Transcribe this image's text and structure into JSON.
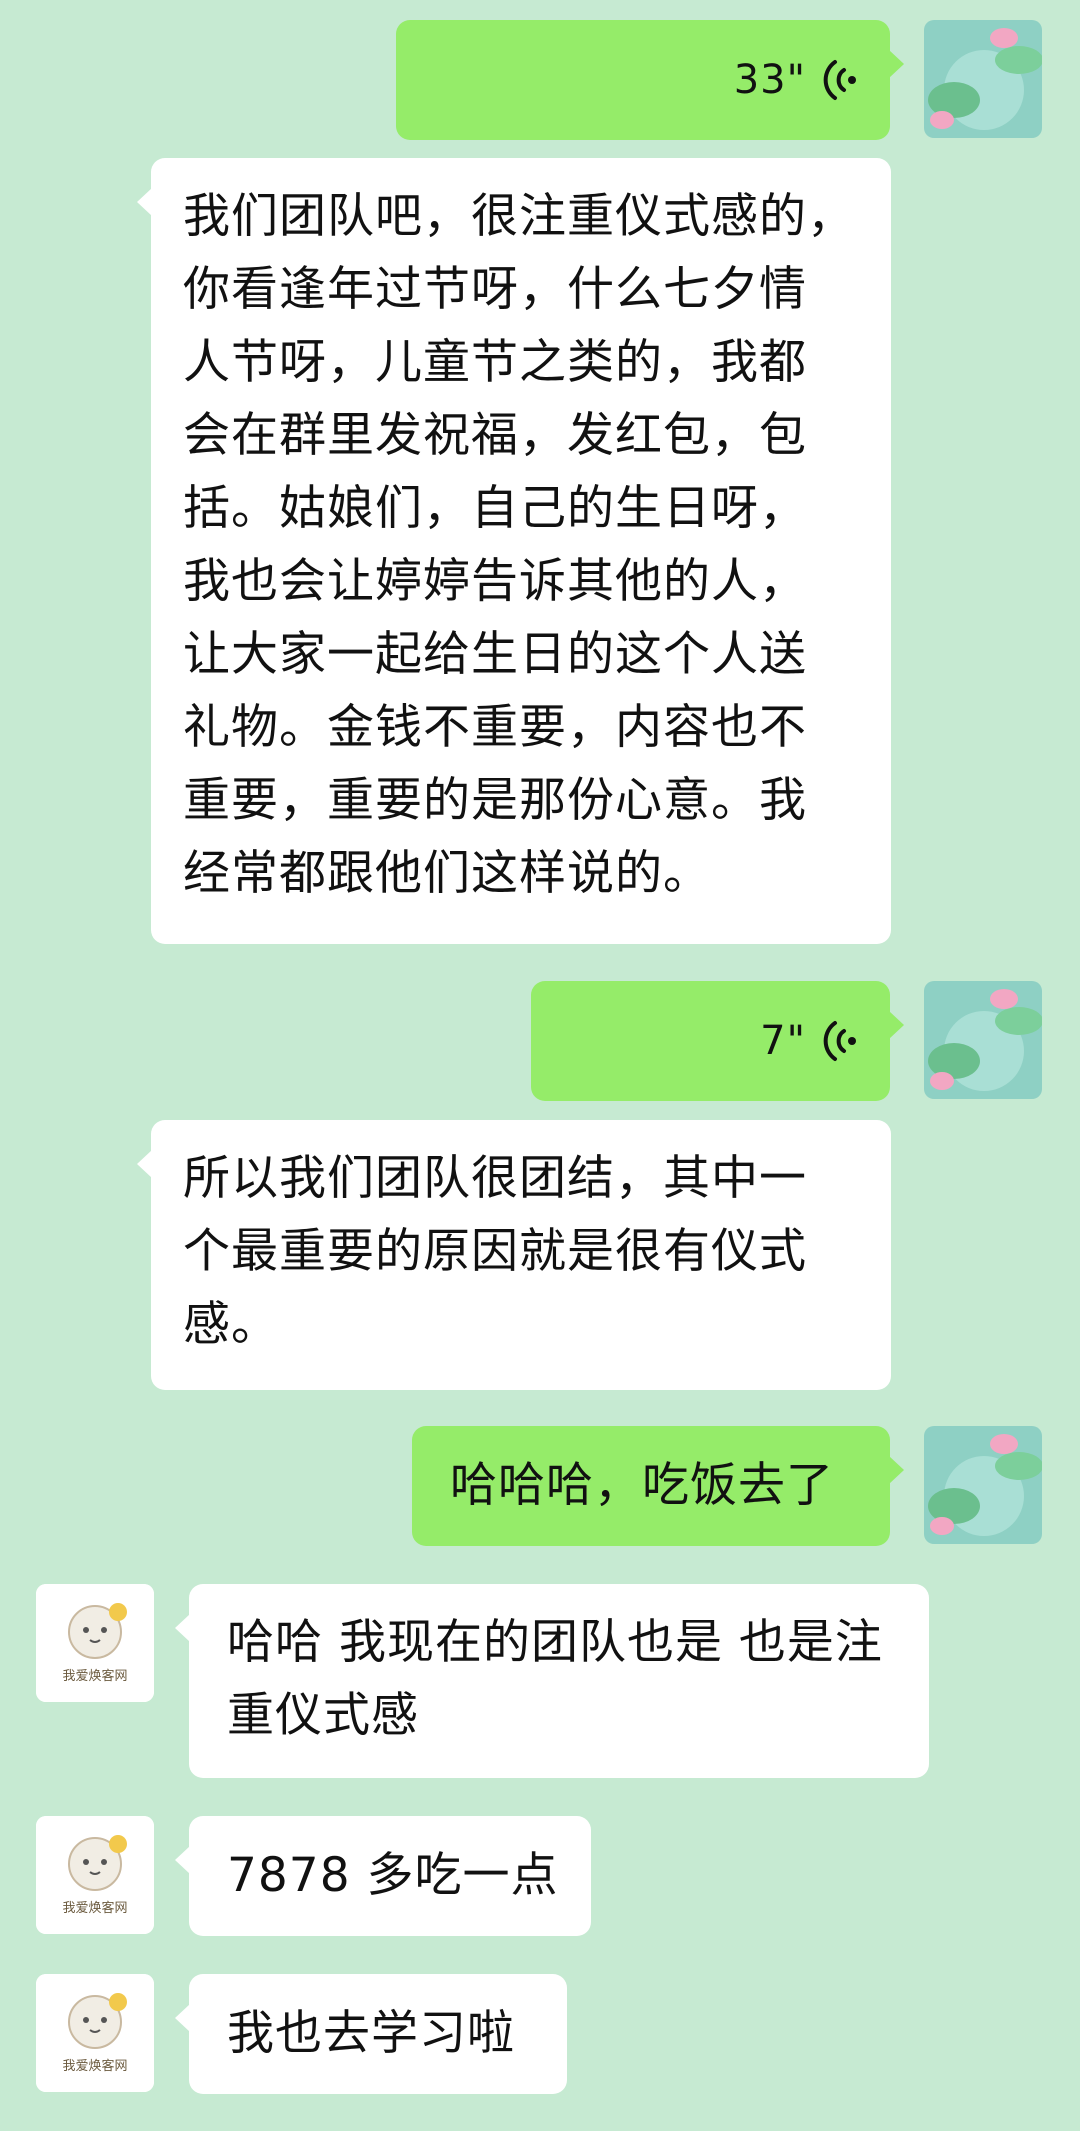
{
  "messages": [
    {
      "side": "out",
      "type": "voice",
      "duration": "33\""
    },
    {
      "side": "in",
      "type": "text",
      "text": "我们团队吧，很注重仪式感的，\n你看逢年过节呀，什么七夕情\n人节呀，儿童节之类的，我都\n会在群里发祝福，发红包，包\n括。姑娘们，自己的生日呀，\n我也会让婷婷告诉其他的人，\n让大家一起给生日的这个人送\n礼物。金钱不重要，内容也不\n重要，重要的是那份心意。我\n经常都跟他们这样说的。"
    },
    {
      "side": "out",
      "type": "voice",
      "duration": "7\""
    },
    {
      "side": "in",
      "type": "text",
      "text": "所以我们团队很团结，其中一\n个最重要的原因就是很有仪式\n感。"
    },
    {
      "side": "out",
      "type": "text",
      "text": "哈哈哈，吃饭去了"
    },
    {
      "side": "in",
      "type": "text",
      "text": "哈哈 我现在的团队也是 也是注\n重仪式感"
    },
    {
      "side": "in",
      "type": "text",
      "text": "7878 多吃一点"
    },
    {
      "side": "in",
      "type": "text",
      "text": "我也去学习啦"
    }
  ],
  "avatars": {
    "self": "lotus-pond-avatar",
    "friend_label": "我爱焕客网",
    "friend_icon": "cat-logo-avatar"
  },
  "colors": {
    "background": "#c6ead2",
    "outgoing_bubble": "#95ec69",
    "incoming_bubble": "#ffffff"
  }
}
